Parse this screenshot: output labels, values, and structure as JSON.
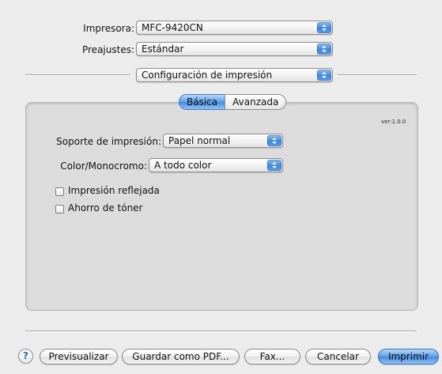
{
  "printer": {
    "label": "Impresora:",
    "value": "MFC-9420CN"
  },
  "presets": {
    "label": "Preajustes:",
    "value": "Estándar"
  },
  "section_popup": {
    "value": "Configuración de impresión"
  },
  "tabs": [
    {
      "label": "Básica",
      "selected": true
    },
    {
      "label": "Avanzada",
      "selected": false
    }
  ],
  "version": "ver:1.0.0",
  "media": {
    "label": "Soporte de impresión:",
    "value": "Papel normal"
  },
  "color_mode": {
    "label": "Color/Monocromo:",
    "value": "A todo color"
  },
  "options": [
    {
      "label": "Impresión reflejada",
      "checked": false
    },
    {
      "label": "Ahorro de tóner",
      "checked": false
    }
  ],
  "buttons": {
    "help": "?",
    "preview": "Previsualizar",
    "save_pdf": "Guardar como PDF...",
    "fax": "Fax...",
    "cancel": "Cancelar",
    "print": "Imprimir"
  },
  "colors": {
    "accent": "#3f8ae3",
    "background": "#ececec",
    "panel": "#dcdcdc"
  }
}
